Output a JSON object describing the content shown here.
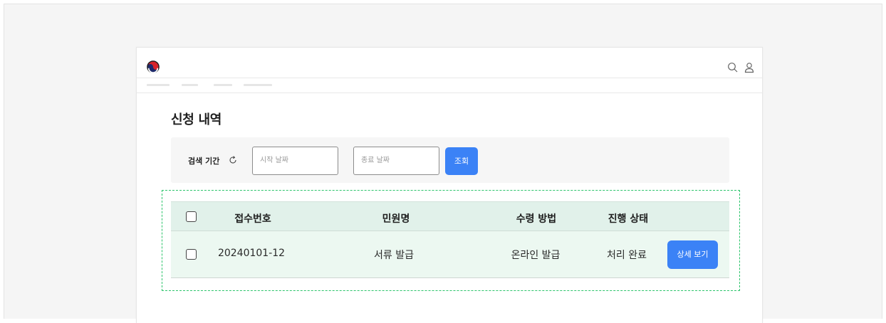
{
  "header": {
    "logo_icon": "taegeuk-logo-icon",
    "search_icon": "search-icon",
    "user_icon": "user-icon"
  },
  "page": {
    "title": "신청 내역"
  },
  "search": {
    "label": "검색 기간",
    "reset_icon": "refresh-icon",
    "start_placeholder": "시작 날짜",
    "separator": "~",
    "end_placeholder": "종료 날짜",
    "query_label": "조회"
  },
  "table": {
    "columns": [
      "접수번호",
      "민원명",
      "수령 방법",
      "진행 상태"
    ],
    "rows": [
      {
        "receipt_no": "20240101-12",
        "petition_name": "서류 발급",
        "receive_method": "온라인 발급",
        "status": "처리 완료",
        "action_label": "상세 보기"
      }
    ]
  },
  "colors": {
    "accent": "#3b82f6",
    "table_header_bg": "#e1f1ea",
    "table_row_bg": "#ecf8f1",
    "selection_outline": "#2cc46b"
  }
}
